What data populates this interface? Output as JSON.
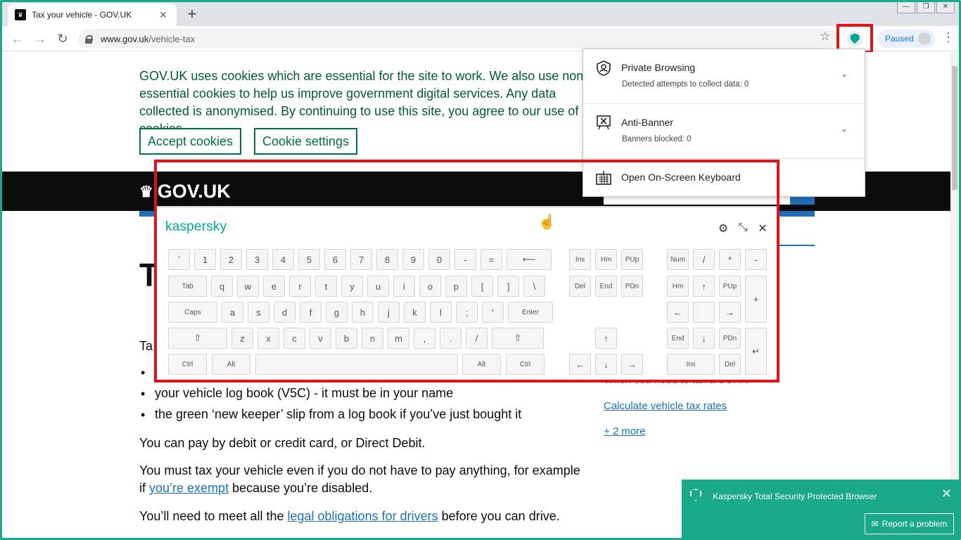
{
  "browser": {
    "tab_title": "Tax your vehicle - GOV.UK",
    "tab_close": "✕",
    "new_tab": "+",
    "url_domain": "www.gov.uk",
    "url_path": "/vehicle-tax",
    "profile_label": "Paused",
    "back": "←",
    "forward": "→",
    "reload": "↻",
    "star": "☆",
    "menu": "⋮"
  },
  "cookies": {
    "text": "GOV.UK uses cookies which are essential for the site to work. We also use non-essential cookies to help us improve government digital services. Any data collected is anonymised. By continuing to use this site, you agree to our use of cookies.",
    "accept": "Accept cookies",
    "settings": "Cookie settings"
  },
  "header": {
    "logo": "GOV.UK",
    "crown": "♛"
  },
  "content": {
    "title_partial": "T",
    "tax_partial": "Ta",
    "bullet2": "your vehicle log book (V5C) - it must be in your name",
    "bullet3": "the green ‘new keeper’ slip from a log book if you’ve just bought it",
    "para_pay": "You can pay by debit or credit card, or Direct Debit.",
    "para_must_1": "You must tax your vehicle even if you do not have to pay anything, for example if ",
    "para_must_link": "you’re exempt",
    "para_must_2": " because you’re disabled.",
    "para_legal_1": "You’ll need to meet all the ",
    "para_legal_link": "legal obligations for drivers",
    "para_legal_2": " before you can drive."
  },
  "sidebar": {
    "link_partial": "When you need to tax a SORN",
    "link_rates": "Calculate vehicle tax rates",
    "link_more": "+ 2 more"
  },
  "kaspersky_menu": {
    "private_title": "Private Browsing",
    "private_sub": "Detected attempts to collect data: 0",
    "banner_title": "Anti-Banner",
    "banner_sub": "Banners blocked: 0",
    "keyboard_title": "Open On-Screen Keyboard",
    "chevron": "⌄"
  },
  "keyboard": {
    "logo": "kaspersky",
    "settings_icon": "⚙",
    "resize_icon": "⤡",
    "close_icon": "✕",
    "row1": [
      "`",
      "1",
      "2",
      "3",
      "4",
      "5",
      "6",
      "7",
      "8",
      "9",
      "0",
      "-",
      "=",
      "⟵"
    ],
    "row2": [
      "Tab",
      "q",
      "w",
      "e",
      "r",
      "t",
      "y",
      "u",
      "i",
      "o",
      "p",
      "[",
      "]",
      "\\"
    ],
    "row3": [
      "Caps",
      "a",
      "s",
      "d",
      "f",
      "g",
      "h",
      "j",
      "k",
      "l",
      ";",
      "'",
      "Enter"
    ],
    "row4": [
      "⇧",
      "z",
      "x",
      "c",
      "v",
      "b",
      "n",
      "m",
      ",",
      ".",
      "/",
      "⇧"
    ],
    "row5": [
      "Ctrl",
      "Alt",
      "",
      "Alt",
      "Ctrl"
    ],
    "nav": [
      "Ins",
      "Hm",
      "PUp",
      "Del",
      "End",
      "PDn",
      "↑",
      "←",
      "↓",
      "→"
    ],
    "numpad": [
      "Num",
      "/",
      "*",
      "-",
      "Hm",
      "↑",
      "PUp",
      "+",
      "←",
      "",
      "→",
      "End",
      "↓",
      "PDn",
      "↵",
      "Ins",
      "Del"
    ]
  },
  "notification": {
    "title": "Kaspersky Total Security Protected Browser",
    "close": "✕",
    "report": "Report a problem"
  },
  "colors": {
    "kaspersky_green": "#00a88e",
    "gov_green": "#00703c",
    "gov_link": "#1d70b8",
    "highlight_red": "#e0131b"
  }
}
